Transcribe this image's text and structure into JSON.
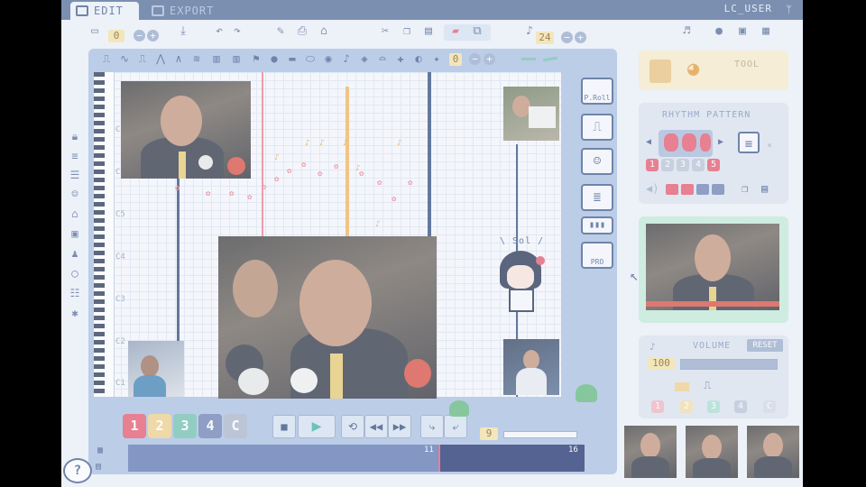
{
  "tabs": {
    "edit": "EDIT",
    "export": "EXPORT"
  },
  "user": {
    "name": "LC_USER",
    "antenna_icon": "antenna-icon"
  },
  "toolbar": {
    "page_value": "0",
    "tempo_value": "24"
  },
  "editor": {
    "octave_value": "0",
    "note_labels": [
      "C7",
      "C6",
      "C5",
      "C4",
      "C3",
      "C2",
      "C1"
    ],
    "solo_label": "\\ Sol /",
    "sidebar_labels": [
      "P.Roll",
      "PRO"
    ]
  },
  "tracks": [
    "1",
    "2",
    "3",
    "4",
    "C"
  ],
  "playback": {
    "page_number": "9"
  },
  "timeline": {
    "marker_start": "11",
    "marker_end": "16"
  },
  "tool_panel": {
    "title": "TOOL"
  },
  "rhythm_panel": {
    "title": "RHYTHM PATTERN",
    "numbers": [
      "1",
      "2",
      "3",
      "4",
      "5"
    ]
  },
  "volume_panel": {
    "title": "VOLUME",
    "reset_label": "RESET",
    "value": "100",
    "level": 1.0,
    "tracks": [
      "1",
      "2",
      "3",
      "4",
      "C"
    ]
  },
  "colors": {
    "accent": "#4f6a96",
    "track1": "#e5556a",
    "track2": "#f0d08a",
    "track3": "#6fc0b0",
    "track4": "#6a7fb0",
    "trackC": "#a9b5c9",
    "playhead": "#f3b45a"
  }
}
